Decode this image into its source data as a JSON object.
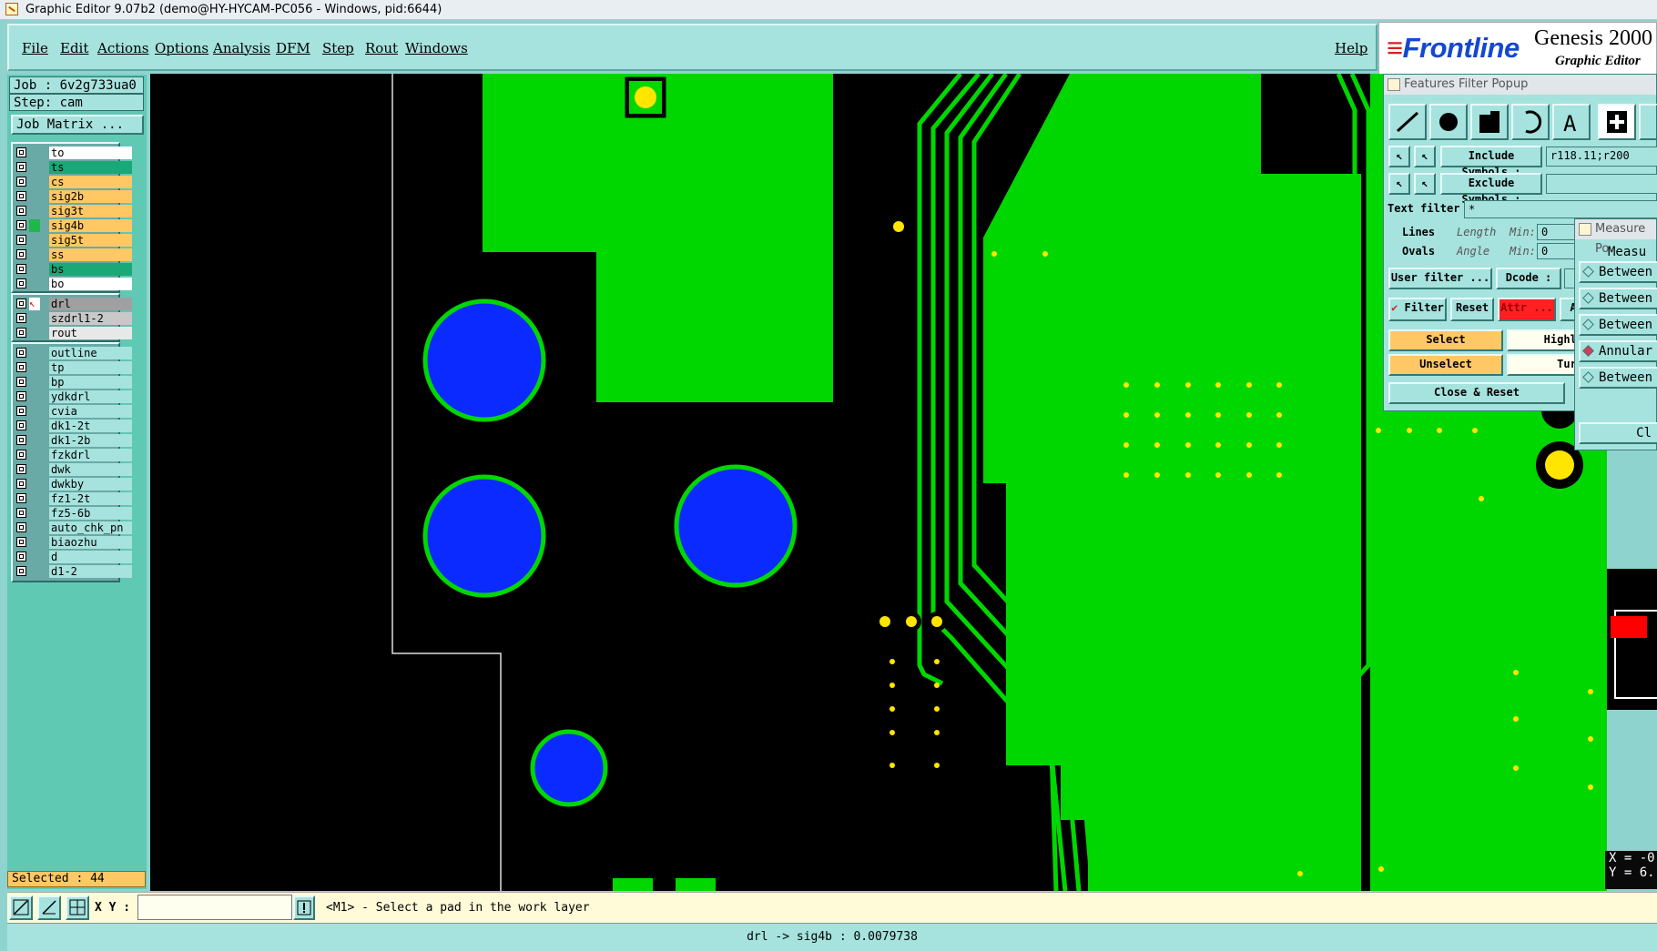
{
  "window": {
    "title": "Graphic Editor 9.07b2 (demo@HY-HYCAM-PC056 - Windows, pid:6644)"
  },
  "menu": {
    "items": [
      "File",
      "Edit",
      "Actions",
      "Options",
      "Analysis",
      "DFM",
      "Step",
      "Rout",
      "Windows"
    ],
    "help": "Help"
  },
  "logo": {
    "brand": "Frontline",
    "product": "Genesis 2000",
    "subtitle": "Graphic Editor"
  },
  "job": {
    "job_label": "Job : 6v2g733ua0",
    "step_label": "Step: cam",
    "matrix_button": "Job Matrix ..."
  },
  "layers": {
    "group1": [
      {
        "name": "to",
        "color": "#ffffff",
        "arrow": true,
        "status": ""
      },
      {
        "name": "ts",
        "color": "#1aa876",
        "arrow": false,
        "status": ""
      },
      {
        "name": "cs",
        "color": "#ffc864",
        "arrow": true,
        "status": ""
      },
      {
        "name": "sig2b",
        "color": "#ffc864",
        "arrow": true,
        "status": ""
      },
      {
        "name": "sig3t",
        "color": "#ffc864",
        "arrow": false,
        "status": ""
      },
      {
        "name": "sig4b",
        "color": "#ffc864",
        "arrow": false,
        "status": "work"
      },
      {
        "name": "sig5t",
        "color": "#ffc864",
        "arrow": true,
        "status": ""
      },
      {
        "name": "ss",
        "color": "#ffc864",
        "arrow": false,
        "status": ""
      },
      {
        "name": "bs",
        "color": "#1aa876",
        "arrow": false,
        "status": ""
      },
      {
        "name": "bo",
        "color": "#ffffff",
        "arrow": true,
        "status": ""
      }
    ],
    "group2": [
      {
        "name": "drl",
        "color": "#a0a0a0",
        "status": "affected"
      },
      {
        "name": "szdrl1-2",
        "color": "#c8c8c8",
        "status": ""
      },
      {
        "name": "rout",
        "color": "#e8e8e8",
        "status": ""
      }
    ],
    "group3": [
      "outline",
      "tp",
      "bp",
      "ydkdrl",
      "cvia",
      "dk1-2t",
      "dk1-2b",
      "fzkdrl",
      "dwk",
      "dwkby",
      "fz1-2t",
      "fz5-6b",
      "auto_chk_pn",
      "biaozhu",
      "d",
      "d1-2"
    ],
    "selected": "Selected : 44"
  },
  "features_popup": {
    "title": "Features Filter Popup",
    "include_label": "Include Symbols :",
    "include_value": "r118.11;r200",
    "exclude_label": "Exclude Symbols :",
    "exclude_value": "",
    "text_filter_label": "Text filter",
    "text_filter_value": "*",
    "lines": "Lines",
    "ovals": "Ovals",
    "length": "Length",
    "angle": "Angle",
    "min1": "Min:",
    "min2": "Min:",
    "min1_val": "0",
    "min2_val": "0",
    "user_filter": "User filter ...",
    "dcode": "Dcode :",
    "filter": "Filter",
    "reset": "Reset",
    "attr": "Attr ...",
    "a": "A",
    "select": "Select",
    "highlight": "Highli",
    "unselect": "Unselect",
    "turn": "Turn",
    "close_reset": "Close & Reset"
  },
  "measure_popup": {
    "title": "Measure Po",
    "header": "Measu",
    "options": [
      "Between",
      "Between",
      "Between",
      "Annular",
      "Between"
    ],
    "selected_index": 3,
    "close": "Cl"
  },
  "coords": {
    "x": "X = -0",
    "y": "Y = 6."
  },
  "bottom": {
    "xy_label": "X Y :",
    "xy_value": "",
    "prompt": "<M1> - Select a pad in the work layer",
    "status": "drl -> sig4b : 0.0079738"
  },
  "colors": {
    "copper": "#00d700",
    "drill": "#0a2aff",
    "pad": "#ffe500",
    "background": "#000000",
    "highlight": "#ff0000"
  }
}
